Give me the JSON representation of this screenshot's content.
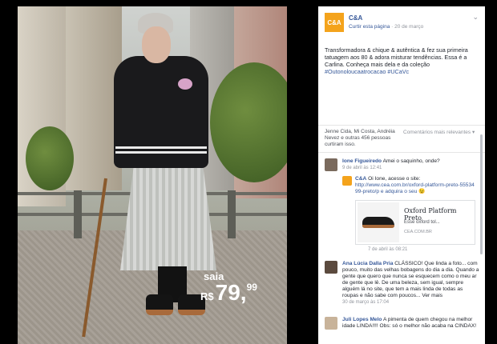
{
  "photo": {
    "price_label": "saia",
    "price_currency": "R$",
    "price_int": "79,",
    "price_cents": "99"
  },
  "post": {
    "page_name": "C&A",
    "logo_text": "C&A",
    "curtir_link": "Curtir esta página",
    "date": "20 de março",
    "body_text": "Transformadora & chique & autêntica & fez sua primeira tatuagem aos 80 & adora misturar tendências. Essa é a Carlina. Conheça mais dela e da coleção ",
    "hashtags": "#Outonoloucaatrocacao #UCaVc"
  },
  "reactions": {
    "text": "Jenne Cida, Mi Costa, Andréia Nevez e outras 456 pessoas curtiram isso.",
    "relevance_label": "Comentários mais relevantes",
    "relevance_arrow": "▾"
  },
  "comments": [
    {
      "author": "Ione Figueiredo",
      "text": "Amei o saquinho, onde?",
      "meta": "9 de abril às 12:41"
    },
    {
      "author": "Ana Lúcia Dalla Pria",
      "text": "CLÁSSICO! Que linda a foto... com pouco, muito das velhas bobagens do dia a dia. Quando a gente que quero que nunca se esquecem como o meu ar de gente que lê. De uma beleza, sem igual, sempre alguém lá no site, que tem a mais linda de todas as roupas e não sabe com poucos... Ver mais",
      "meta": "30 de março às 17:04"
    },
    {
      "author": "Juli Lopes Melo",
      "text": "A pimenta de quem chegou na melhor idade LINDA!!!! Obs: só o melhor não acaba na CINDAX!",
      "meta": ""
    }
  ],
  "reply": {
    "author": "C&A",
    "text": "Oi Ione, acesse o site:",
    "link": "http://www.cea.com.br/oxford-platform-preto-5553499-preto/p e adquira o seu",
    "emoji": "😉",
    "meta": "7 de abril às 08:21"
  },
  "link_card": {
    "title": "Oxford Platform Preto",
    "desc": "Esse oxford tol...",
    "domain": "CEA.COM.BR"
  },
  "icons": {
    "chevron": "chevron-down-icon",
    "logo": "brand-logo"
  },
  "colors": {
    "brand": "#f4a31c",
    "link": "#365899",
    "muted": "#90949c"
  }
}
